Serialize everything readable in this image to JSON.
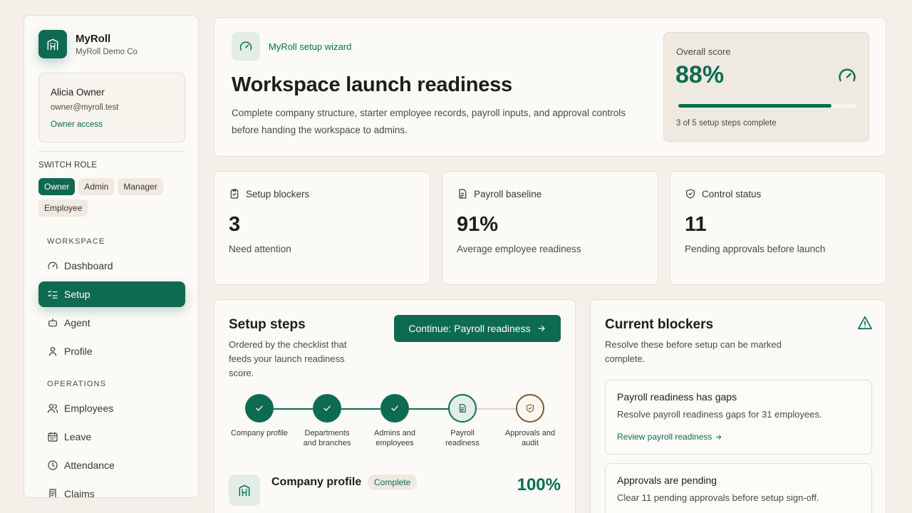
{
  "app": {
    "name": "MyRoll",
    "company": "MyRoll Demo Co"
  },
  "user": {
    "name": "Alicia Owner",
    "email": "owner@myroll.test",
    "access": "Owner access"
  },
  "roles": {
    "label": "SWITCH ROLE",
    "items": [
      "Owner",
      "Admin",
      "Manager",
      "Employee"
    ],
    "active": "Owner"
  },
  "nav": {
    "workspace_label": "WORKSPACE",
    "workspace": [
      {
        "label": "Dashboard",
        "icon": "gauge-icon"
      },
      {
        "label": "Setup",
        "icon": "checklist-icon",
        "active": true
      },
      {
        "label": "Agent",
        "icon": "bot-icon"
      },
      {
        "label": "Profile",
        "icon": "user-icon"
      }
    ],
    "operations_label": "OPERATIONS",
    "operations": [
      {
        "label": "Employees",
        "icon": "users-icon"
      },
      {
        "label": "Leave",
        "icon": "calendar-icon"
      },
      {
        "label": "Attendance",
        "icon": "clock-icon"
      },
      {
        "label": "Claims",
        "icon": "receipt-icon"
      }
    ]
  },
  "hero": {
    "wizard_label": "MyRoll setup wizard",
    "title": "Workspace launch readiness",
    "description": "Complete company structure, starter employee records, payroll inputs, and approval controls before handing the workspace to admins.",
    "score": {
      "label": "Overall score",
      "value": "88%",
      "fraction": 0.86,
      "steps_text": "3 of 5 setup steps complete"
    }
  },
  "stats": [
    {
      "label": "Setup blockers",
      "value": "3",
      "desc": "Need attention",
      "icon": "clipboard-check-icon"
    },
    {
      "label": "Payroll baseline",
      "value": "91%",
      "desc": "Average employee readiness",
      "icon": "document-icon"
    },
    {
      "label": "Control status",
      "value": "11",
      "desc": "Pending approvals before launch",
      "icon": "shield-check-icon"
    }
  ],
  "setup": {
    "title": "Setup steps",
    "description": "Ordered by the checklist that feeds your launch readiness score.",
    "continue_label": "Continue: Payroll readiness",
    "steps": [
      {
        "label_line1": "Company profile",
        "label_line2": "",
        "status": "done"
      },
      {
        "label_line1": "Departments",
        "label_line2": "and branches",
        "status": "done"
      },
      {
        "label_line1": "Admins and",
        "label_line2": "employees",
        "status": "done"
      },
      {
        "label_line1": "Payroll",
        "label_line2": "readiness",
        "status": "current"
      },
      {
        "label_line1": "Approvals and",
        "label_line2": "audit",
        "status": "pending"
      }
    ],
    "row": {
      "title": "Company profile",
      "badge": "Complete",
      "percent": "100%"
    }
  },
  "blockers": {
    "title": "Current blockers",
    "description": "Resolve these before setup can be marked complete.",
    "items": [
      {
        "title": "Payroll readiness has gaps",
        "desc": "Resolve payroll readiness gaps for 31 employees.",
        "link": "Review payroll readiness"
      },
      {
        "title": "Approvals are pending",
        "desc": "Clear 11 pending approvals before setup sign-off.",
        "link": ""
      }
    ]
  },
  "colors": {
    "accent": "#0d6b52",
    "background": "#f4efe8",
    "pending": "#7a5a34"
  }
}
